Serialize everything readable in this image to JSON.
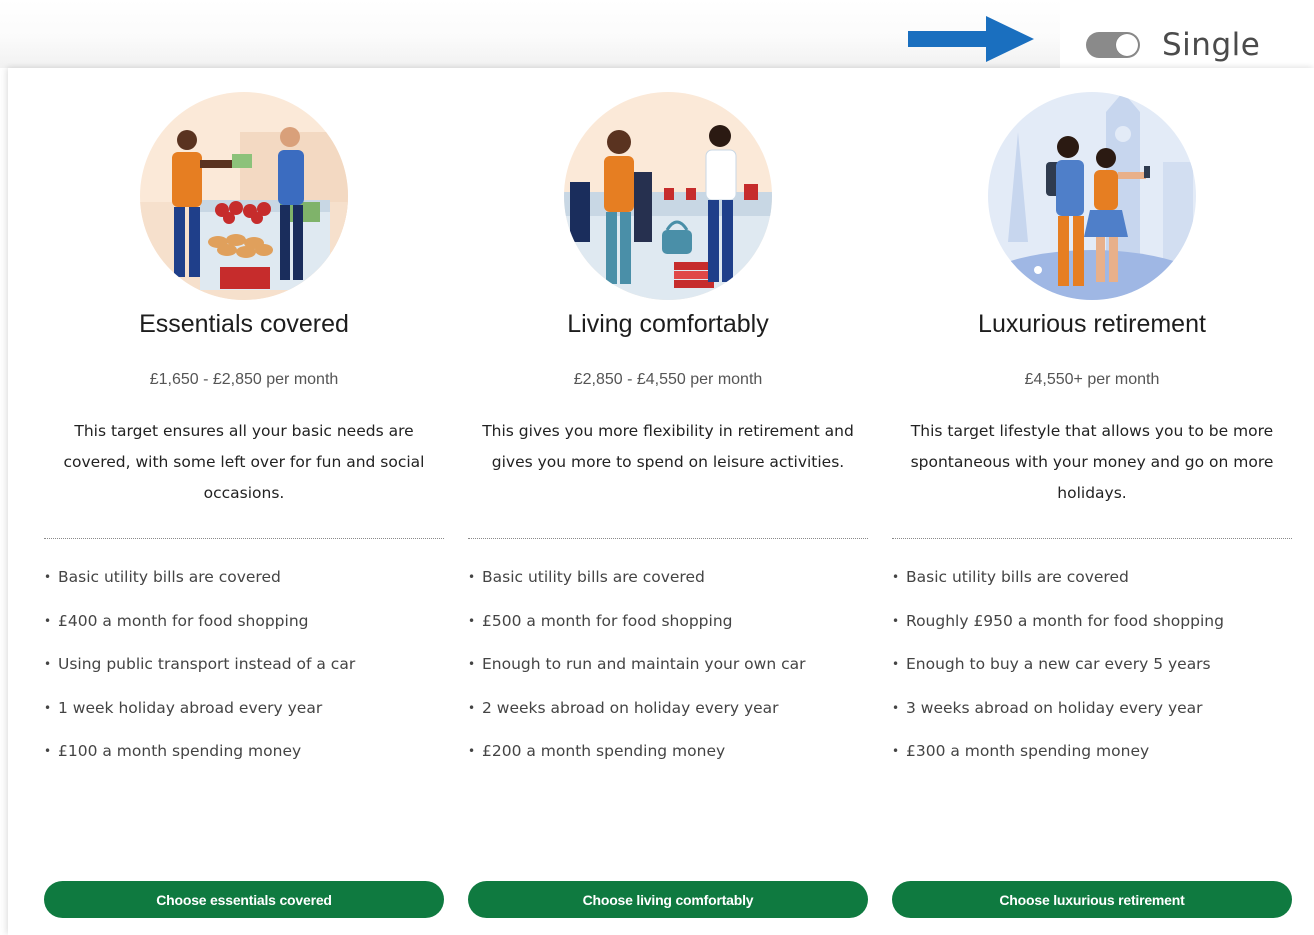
{
  "toggle": {
    "label": "Single",
    "state": "off",
    "track_color": "#8a8a8a"
  },
  "annotation": {
    "arrow_color": "#1a6fbf",
    "icon": "arrow-right-icon"
  },
  "button_color": "#0f7a40",
  "options": [
    {
      "title": "Essentials covered",
      "price": "£1,650 - £2,850 per month",
      "description": "This target ensures all your basic needs are covered, with some left over for fun and social occasions.",
      "features": [
        "Basic utility bills are covered",
        "£400 a month for food shopping",
        "Using public transport instead of a car",
        "1 week holiday abroad every year",
        "£100 a month spending money"
      ],
      "button": "Choose essentials covered",
      "illustration": "grocery-shopping-illustration"
    },
    {
      "title": "Living comfortably",
      "price": "£2,850 - £4,550 per month",
      "description": "This gives you more flexibility in retirement and gives you more to spend on leisure activities.",
      "features": [
        "Basic utility bills are covered",
        "£500 a month for food shopping",
        "Enough to run and maintain your own car",
        "2 weeks abroad on holiday every year",
        "£200 a month spending money"
      ],
      "button": "Choose living comfortably",
      "illustration": "clothes-shopping-illustration"
    },
    {
      "title": "Luxurious retirement",
      "price": "£4,550+ per month",
      "description": "This target lifestyle that allows you to be more spontaneous with your money and go on more holidays.",
      "features": [
        "Basic utility bills are covered",
        "Roughly £950 a month for food shopping",
        "Enough to buy a new car every 5 years",
        "3 weeks abroad on holiday every year",
        "£300 a month spending money"
      ],
      "button": "Choose luxurious retirement",
      "illustration": "travel-illustration"
    }
  ]
}
